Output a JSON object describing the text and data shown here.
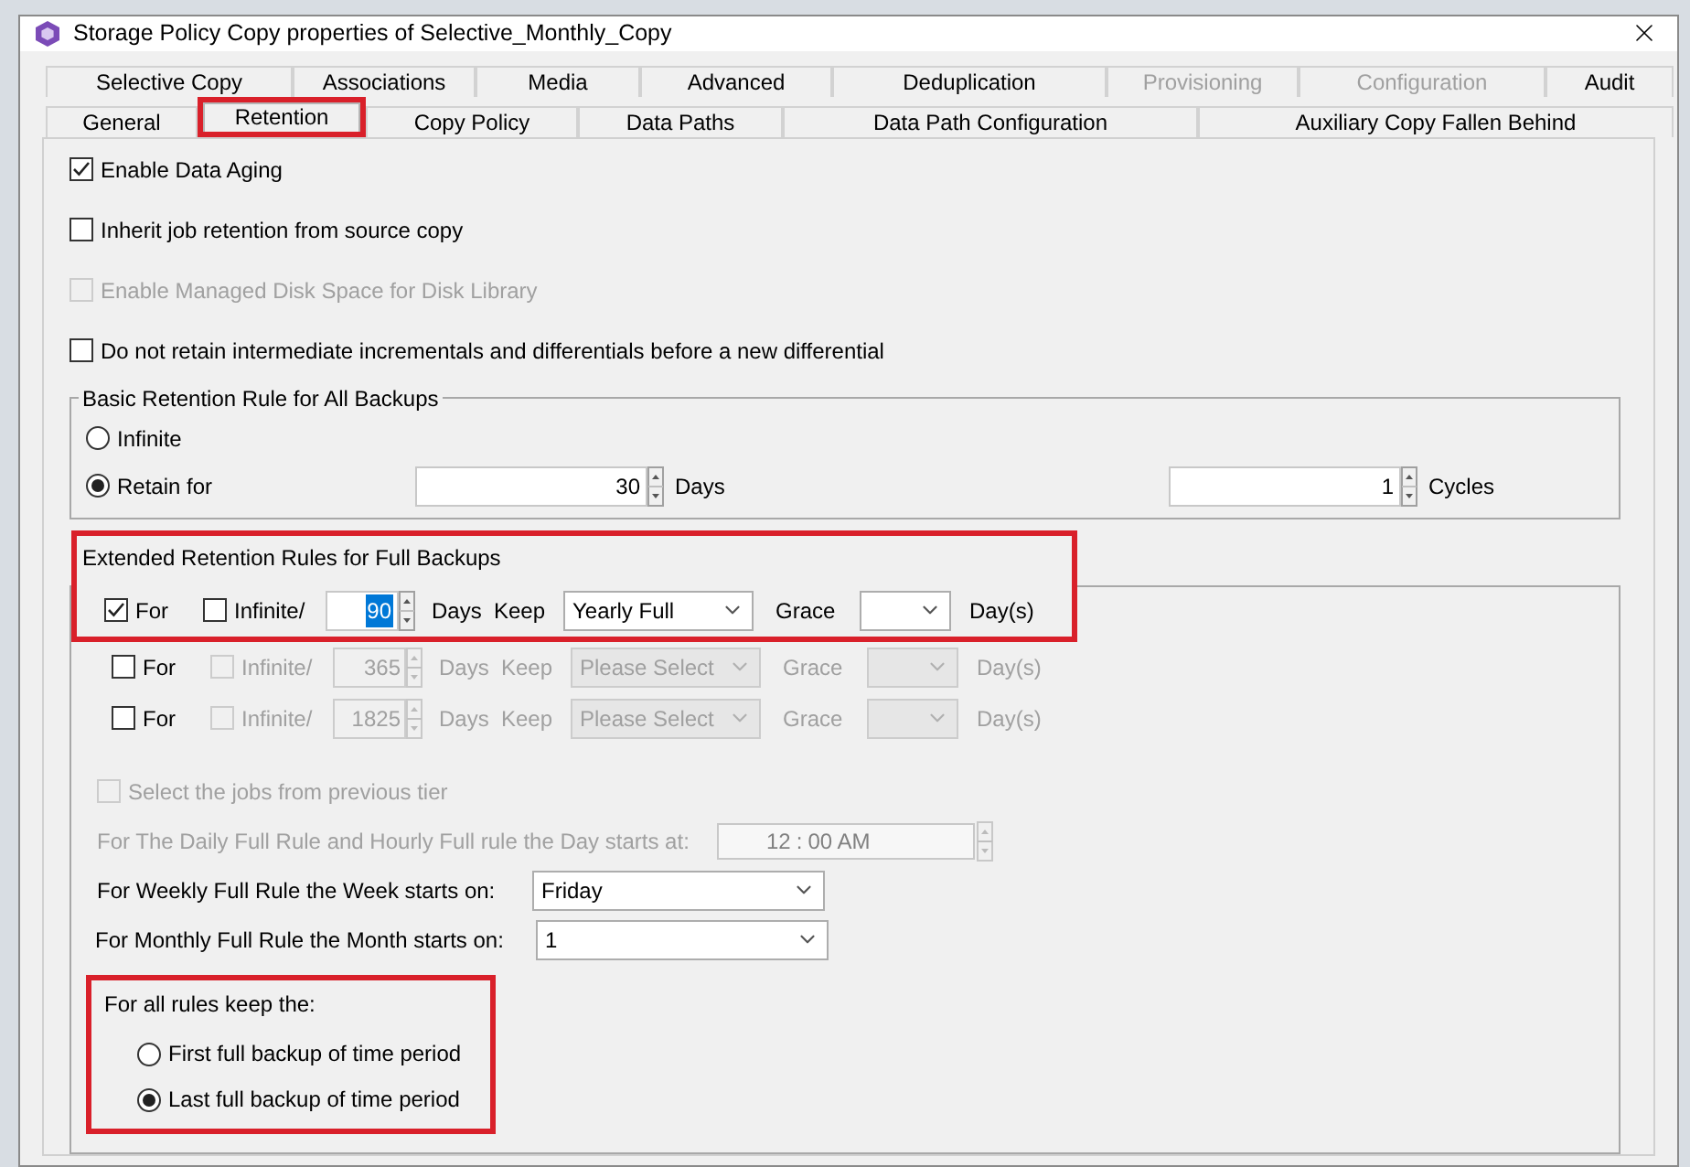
{
  "window": {
    "title": "Storage Policy Copy properties of Selective_Monthly_Copy"
  },
  "tab_rows": [
    [
      {
        "label": "Selective Copy",
        "selected": false,
        "disabled": false
      },
      {
        "label": "Associations",
        "selected": false,
        "disabled": false
      },
      {
        "label": "Media",
        "selected": false,
        "disabled": false
      },
      {
        "label": "Advanced",
        "selected": false,
        "disabled": false
      },
      {
        "label": "Deduplication",
        "selected": false,
        "disabled": false
      },
      {
        "label": "Provisioning",
        "selected": false,
        "disabled": true
      },
      {
        "label": "Configuration",
        "selected": false,
        "disabled": true
      },
      {
        "label": "Audit",
        "selected": false,
        "disabled": false
      }
    ],
    [
      {
        "label": "General",
        "selected": false,
        "disabled": false
      },
      {
        "label": "Retention",
        "selected": true,
        "disabled": false,
        "highlighted": true
      },
      {
        "label": "Copy Policy",
        "selected": false,
        "disabled": false
      },
      {
        "label": "Data Paths",
        "selected": false,
        "disabled": false
      },
      {
        "label": "Data Path Configuration",
        "selected": false,
        "disabled": false
      },
      {
        "label": "Auxiliary Copy Fallen Behind",
        "selected": false,
        "disabled": false
      }
    ]
  ],
  "options": [
    {
      "label": "Enable Data Aging",
      "checked": true,
      "disabled": false
    },
    {
      "label": "Inherit job retention from source copy",
      "checked": false,
      "disabled": false
    },
    {
      "label": "Enable Managed Disk Space for Disk Library",
      "checked": false,
      "disabled": true
    },
    {
      "label": "Do not retain intermediate incrementals and differentials before a new differential",
      "checked": false,
      "disabled": false
    }
  ],
  "basic_retention": {
    "title": "Basic Retention Rule for All Backups",
    "options": [
      {
        "label": "Infinite",
        "selected": false
      },
      {
        "label": "Retain for",
        "selected": true
      }
    ],
    "days": {
      "value": "30",
      "unit": "Days"
    },
    "cycles": {
      "value": "1",
      "unit": "Cycles"
    }
  },
  "extended": {
    "title": "Extended Retention Rules for Full Backups",
    "highlighted": true,
    "rules": [
      {
        "for_label": "For",
        "checked": true,
        "infinite_label": "Infinite/",
        "infinite_checked": false,
        "disabled": false,
        "days": "90",
        "days_selected": true,
        "days_label": "Days",
        "keep_label": "Keep",
        "keep": "Yearly Full",
        "grace_label": "Grace",
        "day_label": "Day(s)"
      },
      {
        "for_label": "For",
        "checked": false,
        "infinite_label": "Infinite/",
        "infinite_checked": false,
        "disabled": true,
        "days": "365",
        "days_selected": false,
        "days_label": "Days",
        "keep_label": "Keep",
        "keep": "Please Select",
        "grace_label": "Grace",
        "day_label": "Day(s)"
      },
      {
        "for_label": "For",
        "checked": false,
        "infinite_label": "Infinite/",
        "infinite_checked": false,
        "disabled": true,
        "days": "1825",
        "days_selected": false,
        "days_label": "Days",
        "keep_label": "Keep",
        "keep": "Please Select",
        "grace_label": "Grace",
        "day_label": "Day(s)"
      }
    ],
    "previous_tier": {
      "label": "Select the jobs from previous tier",
      "checked": false,
      "disabled": true
    },
    "day_start": {
      "label": "For The Daily Full Rule and Hourly Full rule the Day starts at:",
      "hour": "12",
      "separator": ":",
      "minute": "00 AM",
      "disabled": true
    },
    "week_start": {
      "label": "For Weekly Full Rule the Week starts on:",
      "value": "Friday"
    },
    "month_start": {
      "label": "For Monthly Full Rule the Month starts on:",
      "value": "1"
    },
    "keep_rule": {
      "title": "For all rules keep the:",
      "highlighted": true,
      "options": [
        {
          "label": "First full backup of time period",
          "selected": false
        },
        {
          "label": "Last full backup of time period",
          "selected": true
        }
      ]
    }
  }
}
